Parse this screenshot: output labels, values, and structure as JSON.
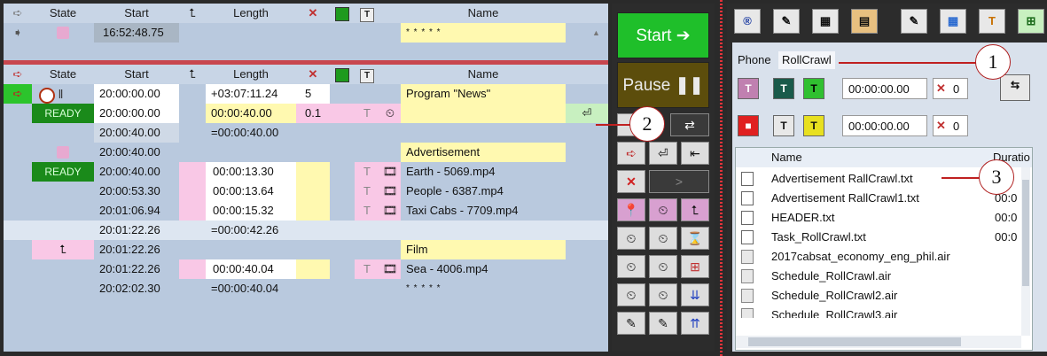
{
  "playlist": {
    "headers": {
      "state": "State",
      "start": "Start",
      "length": "Length",
      "name": "Name"
    },
    "top_row": {
      "start": "16:52:48.75",
      "name": "* * * * *"
    },
    "rows": [
      {
        "state": "",
        "start": "20:00:00.00",
        "length": "+03:07:11.24",
        "count": "5",
        "name": "Program \"News\""
      },
      {
        "state": "READY",
        "start": "20:00:00.00",
        "length": "00:00:40.00",
        "count": "0.1",
        "name": ""
      },
      {
        "state": "",
        "start": "20:00:40.00",
        "length": "=00:00:40.00",
        "count": "",
        "name": ""
      },
      {
        "state": "",
        "start": "20:00:40.00",
        "length": "",
        "count": "",
        "name": "Advertisement"
      },
      {
        "state": "READY",
        "start": "20:00:40.00",
        "length": "00:00:13.30",
        "count": "",
        "name": "Earth - 5069.mp4"
      },
      {
        "state": "",
        "start": "20:00:53.30",
        "length": "00:00:13.64",
        "count": "",
        "name": "People - 6387.mp4"
      },
      {
        "state": "",
        "start": "20:01:06.94",
        "length": "00:00:15.32",
        "count": "",
        "name": "Taxi Cabs - 7709.mp4"
      },
      {
        "state": "",
        "start": "20:01:22.26",
        "length": "=00:00:42.26",
        "count": "",
        "name": ""
      },
      {
        "state": "",
        "start": "20:01:22.26",
        "length": "",
        "count": "",
        "name": "Film"
      },
      {
        "state": "",
        "start": "20:01:22.26",
        "length": "00:00:40.04",
        "count": "",
        "name": "Sea - 4006.mp4"
      },
      {
        "state": "",
        "start": "20:02:02.30",
        "length": "=00:00:40.04",
        "count": "",
        "name": "* * * * *"
      }
    ]
  },
  "controls": {
    "start_label": "Start",
    "pause_label": "Pause"
  },
  "right": {
    "tabs": [
      "Phone",
      "RollCrawl"
    ],
    "time1": "00:00:00.00",
    "count1": "0",
    "time2": "00:00:00.00",
    "count2": "0",
    "file_headers": {
      "name": "Name",
      "duration": "Duratio"
    },
    "files": [
      {
        "name": "Advertisement RallCrawl.txt",
        "duration": "",
        "type": "txt"
      },
      {
        "name": "Advertisement RallCrawl1.txt",
        "duration": "00:0",
        "type": "txt"
      },
      {
        "name": "HEADER.txt",
        "duration": "00:0",
        "type": "txt"
      },
      {
        "name": "Task_RollCrawl.txt",
        "duration": "00:0",
        "type": "txt"
      },
      {
        "name": "2017cabsat_economy_eng_phil.air",
        "duration": "",
        "type": "air"
      },
      {
        "name": "Schedule_RollCrawl.air",
        "duration": "",
        "type": "air"
      },
      {
        "name": "Schedule_RollCrawl2.air",
        "duration": "",
        "type": "air"
      },
      {
        "name": "Schedule_RollCrawl3.air",
        "duration": "",
        "type": "air"
      }
    ]
  },
  "callouts": [
    "1",
    "2",
    "3"
  ],
  "colors": {
    "start_green": "#1fbf2a",
    "pause_olive": "#5c4d0c",
    "ready_green": "#1a8a1a",
    "divider_red": "#c8464e"
  }
}
